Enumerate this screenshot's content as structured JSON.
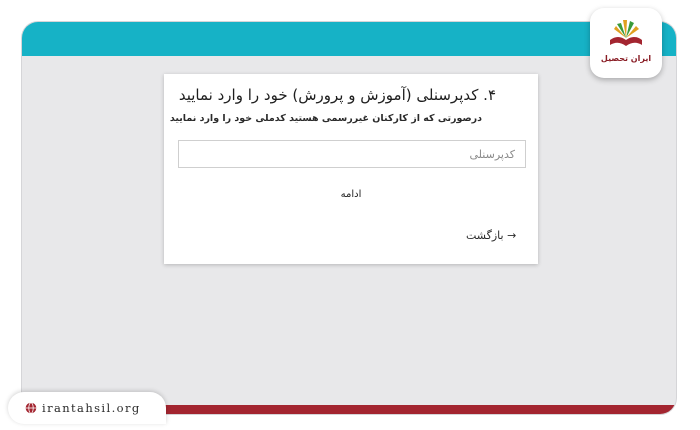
{
  "card": {
    "title": "۴. کدپرسنلی (آموزش و پرورش) خود را وارد نمایید",
    "subtitle": "درصورتی که از کارکنان غیررسمی هستید کدملی خود را وارد نمایید",
    "input_placeholder": "کدپرسنلی",
    "input_value": "",
    "continue_label": "ادامه",
    "back_label": "بازگشت",
    "back_arrow": "→"
  },
  "logo": {
    "text": "ایران تحصیل"
  },
  "footer": {
    "url": "irantahsil.org"
  },
  "colors": {
    "top_band": "#16b2c6",
    "bottom_band": "#a32530",
    "screen_bg": "#e8e8ea",
    "logo_red": "#8a1e26"
  },
  "icons": {
    "globe": "globe-icon",
    "logo_mark": "book-logo-icon"
  }
}
